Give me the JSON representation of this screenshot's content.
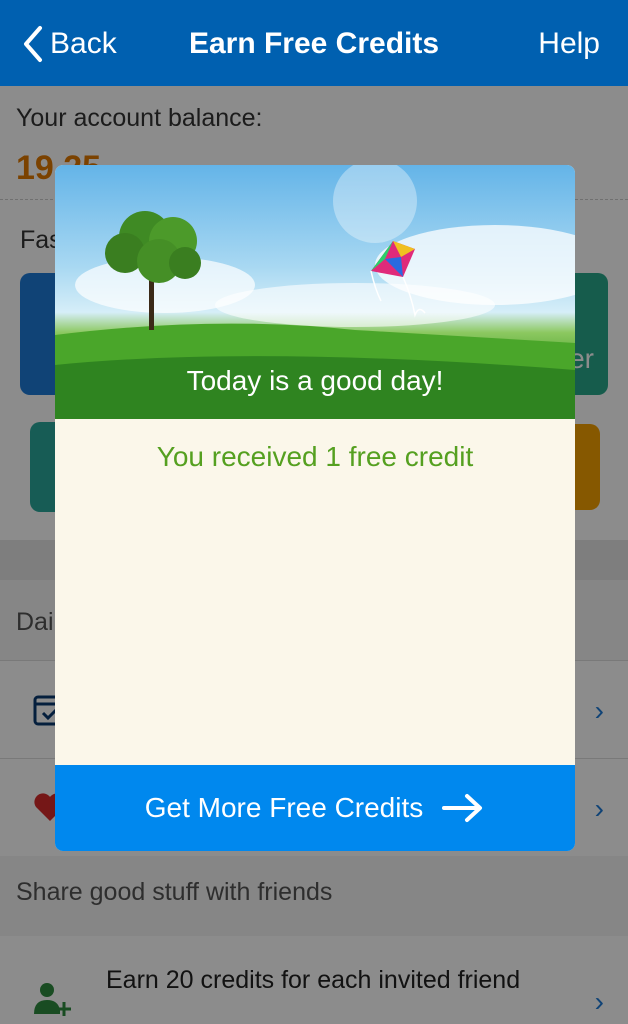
{
  "navbar": {
    "back_label": "Back",
    "title": "Earn Free Credits",
    "help_label": "Help"
  },
  "page": {
    "balance_label": "Your account balance:",
    "balance_value": "19.25",
    "fast_label": "Fas",
    "green_tile_fragment": "er",
    "daily_label": "Dai",
    "share_label": "Share good stuff with friends",
    "invite_text": "Earn 20 credits for each invited friend"
  },
  "modal": {
    "hero_caption": "Today is a good day!",
    "message": "You received 1 free credit",
    "cta_label": "Get More Free Credits"
  },
  "colors": {
    "navbar": "#0060b0",
    "cta": "#0088ee",
    "message": "#55a020",
    "balance": "#e07800",
    "modal_bg": "#fbf7ea"
  },
  "icons": [
    "chevron-left-icon",
    "calendar-icon",
    "heart-icon",
    "add-user-icon",
    "chevron-right-icon",
    "arrow-right-icon"
  ]
}
